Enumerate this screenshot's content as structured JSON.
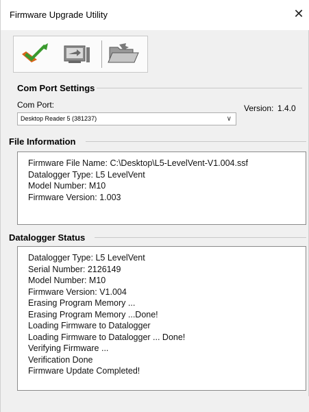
{
  "window": {
    "title": "Firmware Upgrade Utility",
    "close_glyph": "✕"
  },
  "toolbar": {
    "buttons": [
      {
        "name": "upgrade-firmware",
        "icon": "checkmark-arrow-icon"
      },
      {
        "name": "open-device",
        "icon": "monitor-arrow-icon"
      },
      {
        "name": "open-folder",
        "icon": "folder-open-icon"
      }
    ]
  },
  "com_port": {
    "group_title": "Com Port Settings",
    "label": "Com Port:",
    "selected": "Desktop Reader 5 (381237)",
    "version_label": "Version:",
    "version_value": "1.4.0"
  },
  "file_info": {
    "group_title": "File Information",
    "lines": [
      "Firmware File Name: C:\\Desktop\\L5-LevelVent-V1.004.ssf",
      "Datalogger Type: L5 LevelVent",
      "Model Number: M10",
      "Firmware Version: 1.003"
    ]
  },
  "status": {
    "group_title": "Datalogger Status",
    "lines": [
      "Datalogger Type: L5 LevelVent",
      "Serial Number: 2126149",
      "Model Number: M10",
      "Firmware Version: V1.004",
      "Erasing Program Memory ...",
      "Erasing Program Memory ...Done!",
      "Loading Firmware to Datalogger",
      "Loading Firmware to Datalogger ... Done!",
      "Verifying Firmware ...",
      "Verification Done",
      "Firmware Update Completed!"
    ]
  },
  "colors": {
    "window_bg": "#f0f0f0",
    "panel_bg": "#ffffff",
    "accent_green": "#3a9a2e",
    "accent_orange": "#d8641a"
  }
}
